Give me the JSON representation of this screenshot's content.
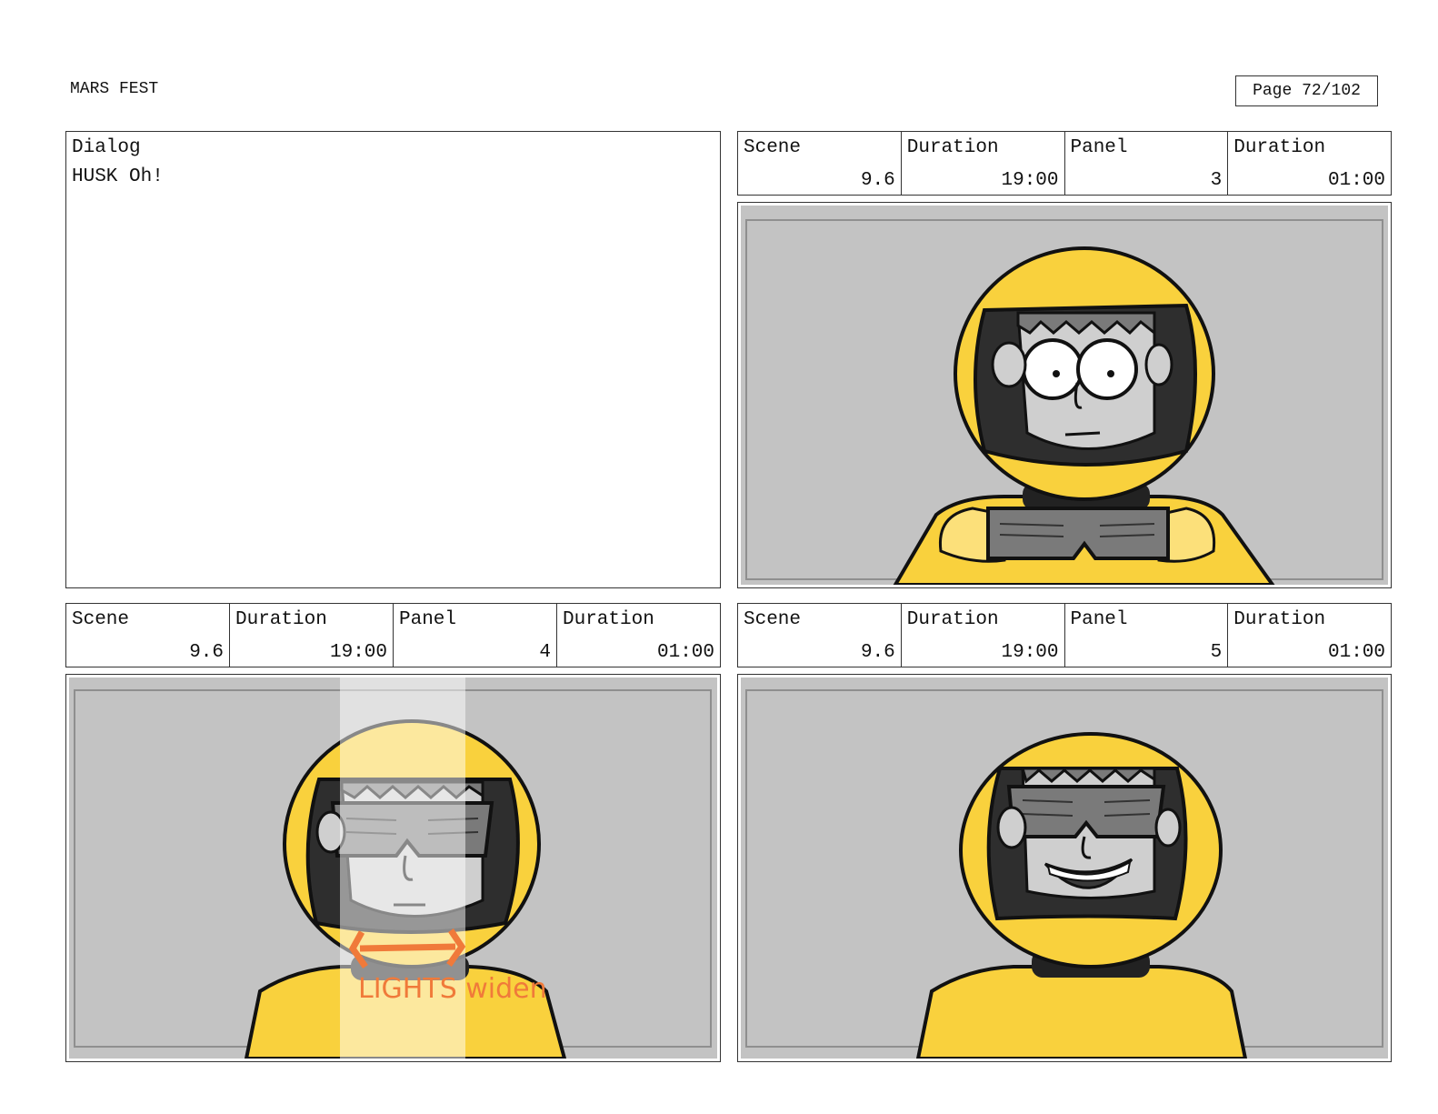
{
  "document": {
    "title": "MARS FEST",
    "page_label": "Page",
    "page_number": "72/102"
  },
  "dialog": {
    "label": "Dialog",
    "text": "HUSK Oh!"
  },
  "panels": [
    {
      "scene_label": "Scene",
      "scene": "9.6",
      "duration_label": "Duration",
      "scene_duration": "19:00",
      "panel_label": "Panel",
      "panel": "3",
      "panel_duration_label": "Duration",
      "panel_duration": "01:00"
    },
    {
      "scene_label": "Scene",
      "scene": "9.6",
      "duration_label": "Duration",
      "scene_duration": "19:00",
      "panel_label": "Panel",
      "panel": "4",
      "panel_duration_label": "Duration",
      "panel_duration": "01:00",
      "annotation": "LIGHTS widen"
    },
    {
      "scene_label": "Scene",
      "scene": "9.6",
      "duration_label": "Duration",
      "scene_duration": "19:00",
      "panel_label": "Panel",
      "panel": "5",
      "panel_duration_label": "Duration",
      "panel_duration": "01:00"
    }
  ],
  "colors": {
    "suit_yellow": "#F9D13D",
    "background_gray": "#C3C3C3",
    "annotation_orange": "#F07A3A"
  }
}
